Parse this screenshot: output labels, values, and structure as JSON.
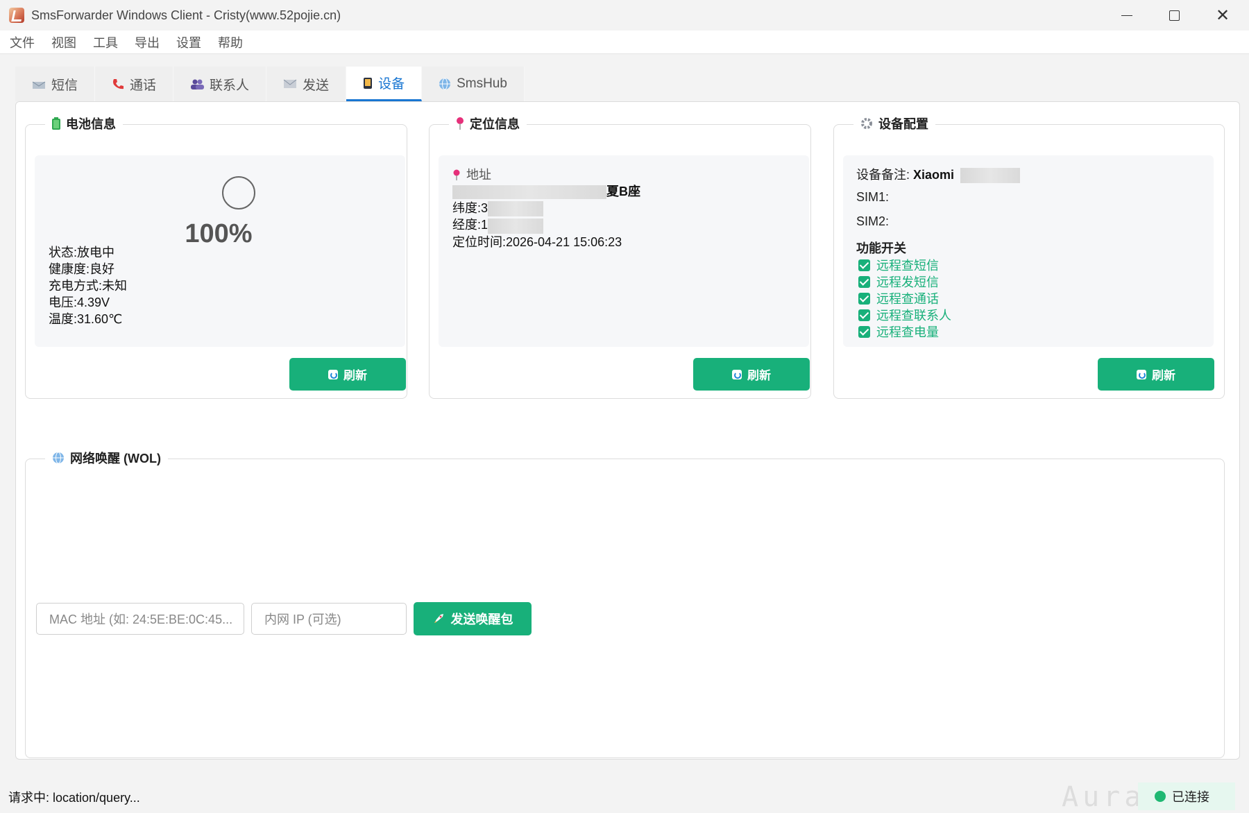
{
  "window": {
    "title": "SmsForwarder Windows Client - Cristy(www.52pojie.cn)",
    "minimize": "–",
    "close": "✕"
  },
  "menu": [
    "文件",
    "视图",
    "工具",
    "导出",
    "设置",
    "帮助"
  ],
  "tabs": [
    {
      "label": "短信",
      "icon": "sms-icon"
    },
    {
      "label": "通话",
      "icon": "phone-icon"
    },
    {
      "label": "联系人",
      "icon": "contacts-icon"
    },
    {
      "label": "发送",
      "icon": "send-icon"
    },
    {
      "label": "设备",
      "icon": "device-icon",
      "active": true
    },
    {
      "label": "SmsHub",
      "icon": "globe-icon"
    }
  ],
  "battery": {
    "title": "电池信息",
    "percent": "100%",
    "status": "状态:放电中",
    "health": "健康度:良好",
    "charge": "充电方式:未知",
    "voltage": "电压:4.39V",
    "temperature": "温度:31.60℃",
    "refresh": "刷新"
  },
  "location": {
    "title": "定位信息",
    "address_label": "地址",
    "address_tail": "夏B座",
    "lat": "纬度:3",
    "lng": "经度:1",
    "time": "定位时间:2026-04-21 15:06:23",
    "refresh": "刷新"
  },
  "config": {
    "title": "设备配置",
    "remark_label": "设备备注: ",
    "remark_value": "Xiaomi",
    "sim1": "SIM1:",
    "sim2": "SIM2:",
    "switch_title": "功能开关",
    "switches": [
      "远程查短信",
      "远程发短信",
      "远程查通话",
      "远程查联系人",
      "远程查电量"
    ],
    "refresh": "刷新"
  },
  "wol": {
    "title": "网络唤醒 (WOL)",
    "mac_placeholder": "MAC 地址 (如: 24:5E:BE:0C:45...",
    "ip_placeholder": "内网 IP (可选)",
    "send": "发送唤醒包"
  },
  "status": {
    "text": "请求中: location/query...",
    "connection": "已连接",
    "watermark": "Aura Service"
  },
  "colors": {
    "accent": "#18b07a",
    "tab_active": "#1976d2"
  }
}
